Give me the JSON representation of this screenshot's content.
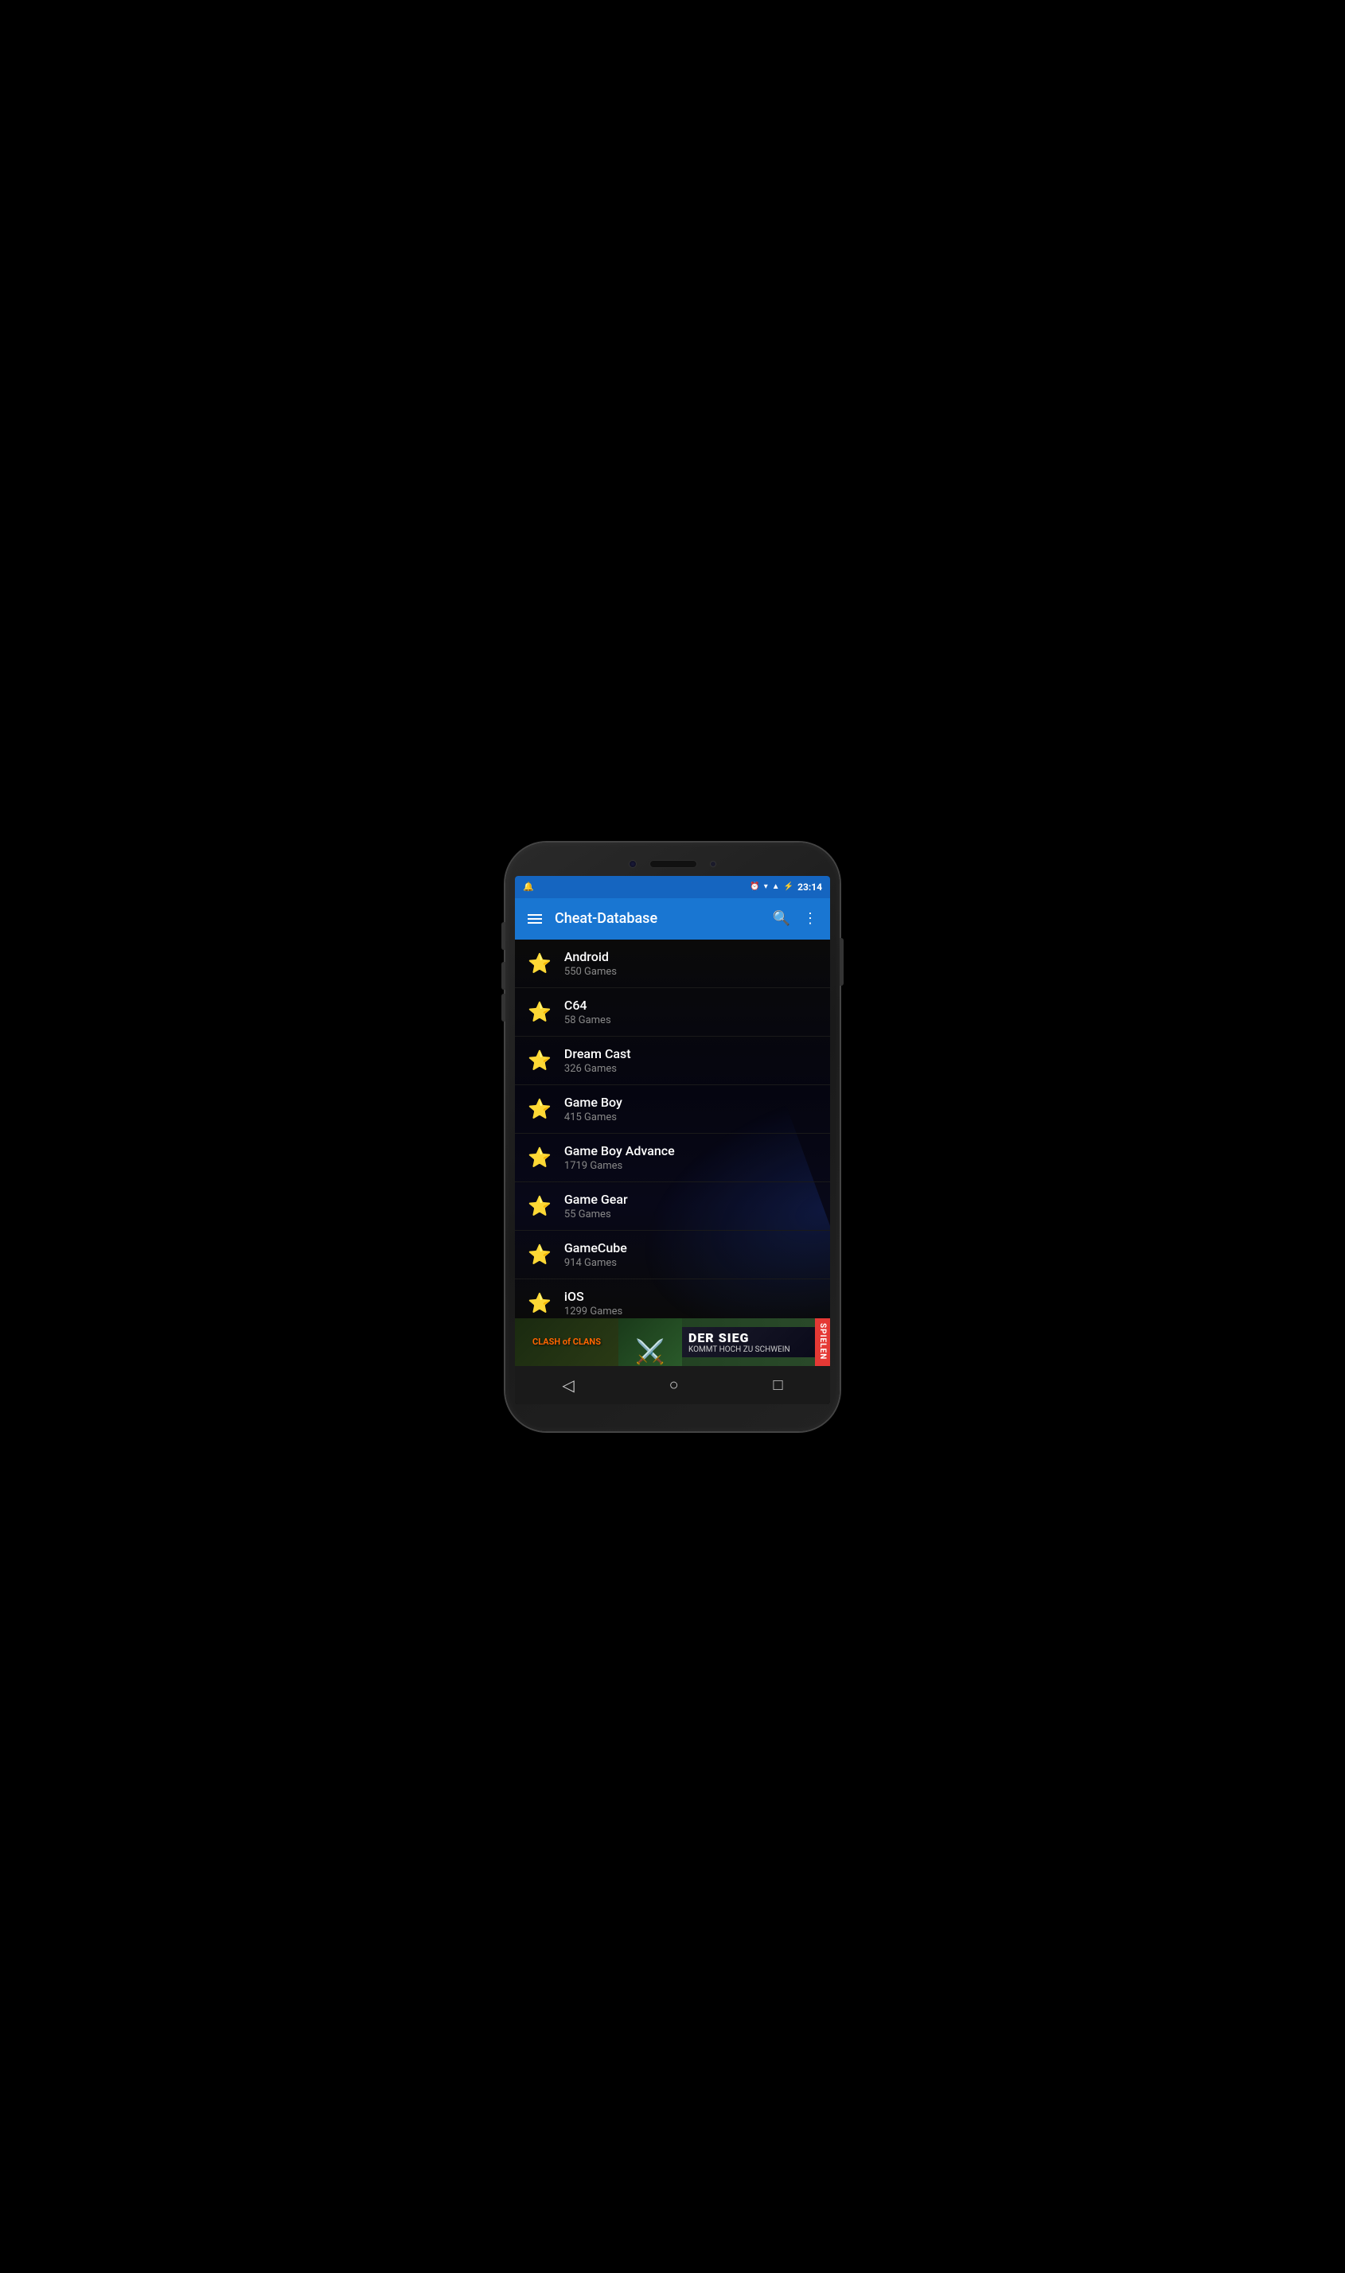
{
  "statusBar": {
    "time": "23:14",
    "icons": [
      "alarm",
      "wifi",
      "signal",
      "battery"
    ]
  },
  "toolbar": {
    "title": "Cheat-Database",
    "menuLabel": "menu",
    "searchLabel": "search",
    "moreLabel": "more options"
  },
  "listItems": [
    {
      "id": "android",
      "name": "Android",
      "count": "550 Games"
    },
    {
      "id": "c64",
      "name": "C64",
      "count": "58 Games"
    },
    {
      "id": "dreamcast",
      "name": "Dream Cast",
      "count": "326 Games"
    },
    {
      "id": "gameboy",
      "name": "Game Boy",
      "count": "415 Games"
    },
    {
      "id": "gameboyadvance",
      "name": "Game Boy Advance",
      "count": "1719 Games"
    },
    {
      "id": "gamegear",
      "name": "Game Gear",
      "count": "55 Games"
    },
    {
      "id": "gamecube",
      "name": "GameCube",
      "count": "914 Games"
    },
    {
      "id": "ios",
      "name": "iOS",
      "count": "1299 Games"
    }
  ],
  "ad": {
    "brand": "CLASH of CLANS",
    "headline": "DER SIEG",
    "subtext": "KOMMT HOCH ZU SCHWEIN",
    "cta": "SPIELEN"
  },
  "navBar": {
    "back": "◁",
    "home": "○",
    "recent": "□"
  }
}
